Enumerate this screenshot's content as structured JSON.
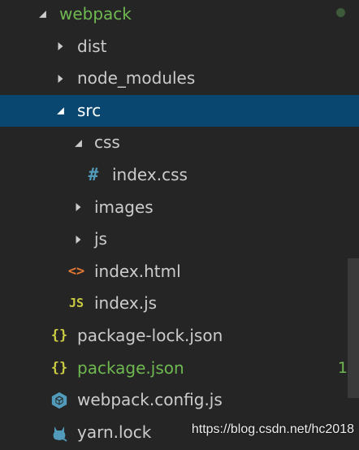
{
  "explorer": {
    "root": {
      "label": "webpack"
    },
    "items": [
      {
        "label": "dist"
      },
      {
        "label": "node_modules"
      },
      {
        "label": "src"
      },
      {
        "label": "css"
      },
      {
        "label": "index.css",
        "icon": "#"
      },
      {
        "label": "images"
      },
      {
        "label": "js"
      },
      {
        "label": "index.html",
        "icon": "<>"
      },
      {
        "label": "index.js",
        "icon": "JS"
      },
      {
        "label": "package-lock.json",
        "icon": "{}"
      },
      {
        "label": "package.json",
        "icon": "{}",
        "badge": "1"
      },
      {
        "label": "webpack.config.js"
      },
      {
        "label": "yarn.lock"
      }
    ]
  },
  "watermark": "https://blog.csdn.net/hc2018",
  "colors": {
    "background": "#252526",
    "selection": "#094771",
    "modified_green": "#6fb950",
    "css_icon": "#519aba",
    "html_icon": "#e37933",
    "js_icon": "#cbcb41",
    "json_icon": "#cbcb41",
    "webpack_icon": "#519aba",
    "yarn_icon": "#519aba"
  }
}
